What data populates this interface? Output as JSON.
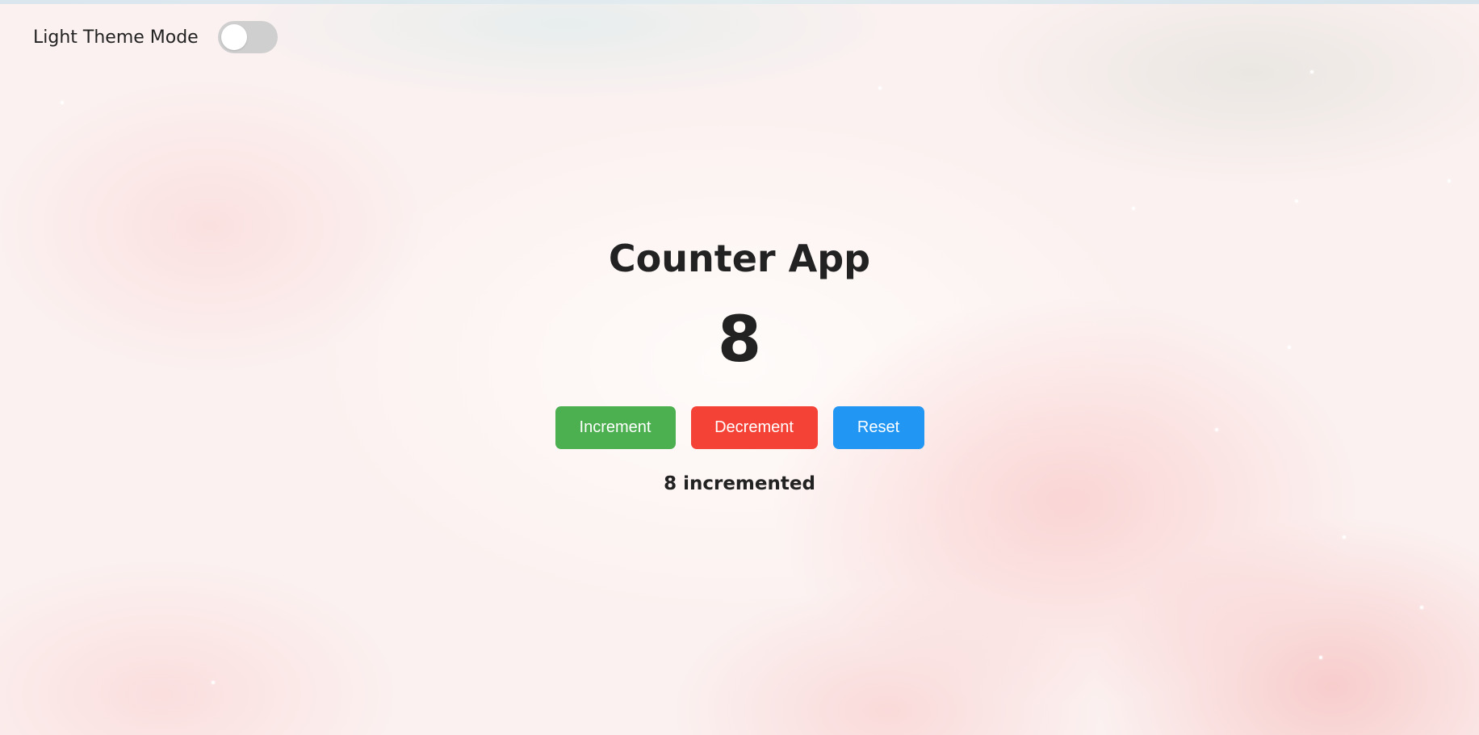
{
  "theme_toggle": {
    "label": "Light Theme Mode",
    "checked": false
  },
  "app": {
    "title": "Counter App",
    "count": "8",
    "status": "8 incremented"
  },
  "buttons": {
    "increment": "Increment",
    "decrement": "Decrement",
    "reset": "Reset"
  },
  "colors": {
    "increment": "#4caf50",
    "decrement": "#f44336",
    "reset": "#2196f3",
    "text": "#222222",
    "toggle_off": "#cfcfcf"
  }
}
